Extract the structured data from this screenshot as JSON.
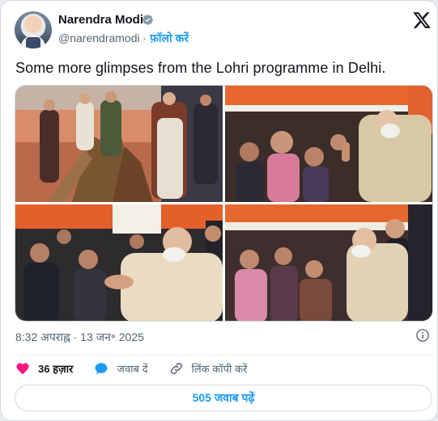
{
  "author": {
    "name": "Narendra Modi",
    "handle": "@narendramodi",
    "separator": "·",
    "follow_label": "फ़ॉलो करें",
    "verified_color": "#829aab"
  },
  "brand_icon": "x-logo-icon",
  "tweet": {
    "text": "Some more glimpses from the Lohri programme in Delhi.",
    "images": [
      {
        "name": "photo-bonfire",
        "icon": "photo"
      },
      {
        "name": "photo-crowd-greeting",
        "icon": "photo"
      },
      {
        "name": "photo-handshake",
        "icon": "photo"
      },
      {
        "name": "photo-crowd-selfie",
        "icon": "photo"
      }
    ]
  },
  "meta": {
    "timestamp": "8:32 अपराह्न · 13 जन॰ 2025"
  },
  "actions": {
    "likes": "36 हज़ार",
    "reply_label": "जवाब दें",
    "copy_link_label": "लिंक कॉपी करें"
  },
  "footer": {
    "read_replies_label": "505 जवाब पढ़ें"
  },
  "colors": {
    "accent": "#1d9bf0",
    "like": "#f91880",
    "text_secondary": "#536471"
  }
}
